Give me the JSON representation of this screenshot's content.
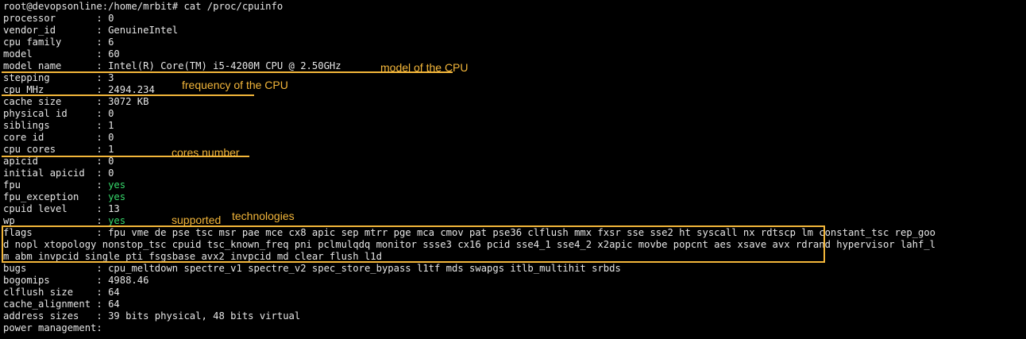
{
  "terminal": {
    "prompt": "root@devopsonline:/home/mrbit# cat /proc/cpuinfo",
    "rows": [
      {
        "key": "processor",
        "value": "0"
      },
      {
        "key": "vendor_id",
        "value": "GenuineIntel"
      },
      {
        "key": "cpu family",
        "value": "6"
      },
      {
        "key": "model",
        "value": "60"
      },
      {
        "key": "model name",
        "value": "Intel(R) Core(TM) i5-4200M CPU @ 2.50GHz"
      },
      {
        "key": "stepping",
        "value": "3"
      },
      {
        "key": "cpu MHz",
        "value": "2494.234"
      },
      {
        "key": "cache size",
        "value": "3072 KB"
      },
      {
        "key": "physical id",
        "value": "0"
      },
      {
        "key": "siblings",
        "value": "1"
      },
      {
        "key": "core id",
        "value": "0"
      },
      {
        "key": "cpu cores",
        "value": "1"
      },
      {
        "key": "apicid",
        "value": "0"
      },
      {
        "key": "initial apicid",
        "value": "0"
      },
      {
        "key": "fpu",
        "value": "yes",
        "highlight": true
      },
      {
        "key": "fpu_exception",
        "value": "yes",
        "highlight": true
      },
      {
        "key": "cpuid level",
        "value": "13"
      },
      {
        "key": "wp",
        "value": "yes",
        "highlight": true
      }
    ],
    "flags": {
      "key": "flags",
      "lines": [
        "fpu vme de pse tsc msr pae mce cx8 apic sep mtrr pge mca cmov pat pse36 clflush mmx fxsr sse sse2 ht syscall nx rdtscp lm constant_tsc rep_goo",
        "d nopl xtopology nonstop_tsc cpuid tsc_known_freq pni pclmulqdq monitor ssse3 cx16 pcid sse4_1 sse4_2 x2apic movbe popcnt aes xsave avx rdrand hypervisor lahf_l",
        "m abm invpcid_single pti fsgsbase avx2 invpcid md_clear flush_l1d"
      ]
    },
    "rows_after": [
      {
        "key": "bugs",
        "value": "cpu_meltdown spectre_v1 spectre_v2 spec_store_bypass l1tf mds swapgs itlb_multihit srbds"
      },
      {
        "key": "bogomips",
        "value": "4988.46"
      },
      {
        "key": "clflush size",
        "value": "64"
      },
      {
        "key": "cache_alignment",
        "value": "64"
      },
      {
        "key": "address sizes",
        "value": "39 bits physical, 48 bits virtual"
      },
      {
        "key": "power management",
        "value": ""
      }
    ]
  },
  "annotations": {
    "model": "model of the CPU",
    "frequency": "frequency of the CPU",
    "cores": "cores number",
    "supported": "supported",
    "technologies": "technologies"
  },
  "colors": {
    "background": "#000000",
    "text": "#e6e6e6",
    "green": "#36d96b",
    "annotation": "#f3b63a"
  }
}
